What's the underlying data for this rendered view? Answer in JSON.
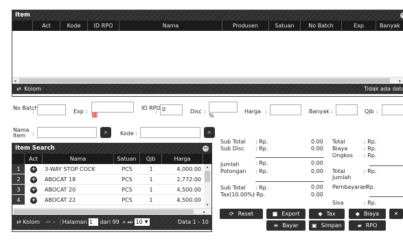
{
  "item_panel": {
    "title": "Item",
    "columns": [
      "Act",
      "Kode",
      "ID RPO",
      "Nama",
      "Produsen",
      "Satuan",
      "No Batch",
      "Exp",
      "Banyak"
    ],
    "footer_kolom": "Kolom",
    "footer_status": "Tidak ada data"
  },
  "form": {
    "no_batch_label": "No Batch",
    "exp_label": "Exp",
    "id_rpo_label": "ID RPO",
    "id_rpo_value": "0",
    "disc_label": "Disc",
    "disc_unit": "%",
    "harga_label": "Harga",
    "banyak_label": "Banyak",
    "qjb_label": "Qjb",
    "nama_item_label": "Nama Item",
    "kode_label": "Kode",
    "sep": ":"
  },
  "item_search": {
    "title": "Item Search",
    "columns": [
      "Act",
      "Nama",
      "Satuan",
      "Qjb",
      "Harga"
    ],
    "rows": [
      {
        "no": "1",
        "nama": "3-WAY STOP COCK",
        "satuan": "PCS",
        "qjb": "1",
        "harga": "4,000.00"
      },
      {
        "no": "2",
        "nama": "ABOCAT 18",
        "satuan": "PCS",
        "qjb": "1",
        "harga": "2,772.00"
      },
      {
        "no": "3",
        "nama": "ABOCAT 20",
        "satuan": "PCS",
        "qjb": "1",
        "harga": "4,500.00"
      },
      {
        "no": "4",
        "nama": "ABOCAT 22",
        "satuan": "PCS",
        "qjb": "1",
        "harga": "4,500.00"
      }
    ],
    "pager": {
      "kolom": "Kolom",
      "halaman_label": "Halaman",
      "page_value": "1",
      "dari": "dari 99",
      "page_size": "10",
      "data_info": "Data 1 - 10"
    }
  },
  "summary": {
    "sub_total_label": "Sub Total",
    "sub_disc_label": "Sub Disc",
    "jumlah_label": "Jumlah",
    "potongan_label": "Potongan",
    "sub_total2_label": "Sub Total",
    "tax_label": "Tax(10.00%)",
    "rp_prefix": ": Rp.",
    "zero": "0.00",
    "total_label": "Total",
    "biaya_label": "Biaya",
    "ongkos_label": "Ongkos",
    "total_jumlah_label": "Total Jumlah",
    "pembayaran_label": "Pembayaran",
    "sisa_label": "Sisa"
  },
  "buttons": {
    "reset": "Reset",
    "export": "Export",
    "tax": "Tax",
    "biaya": "Biaya",
    "bayar": "Bayar",
    "simpan": "Simpan",
    "rpo": "RPO"
  },
  "icons": {
    "search": "⌕",
    "plus": "+",
    "calendar": "▦"
  }
}
